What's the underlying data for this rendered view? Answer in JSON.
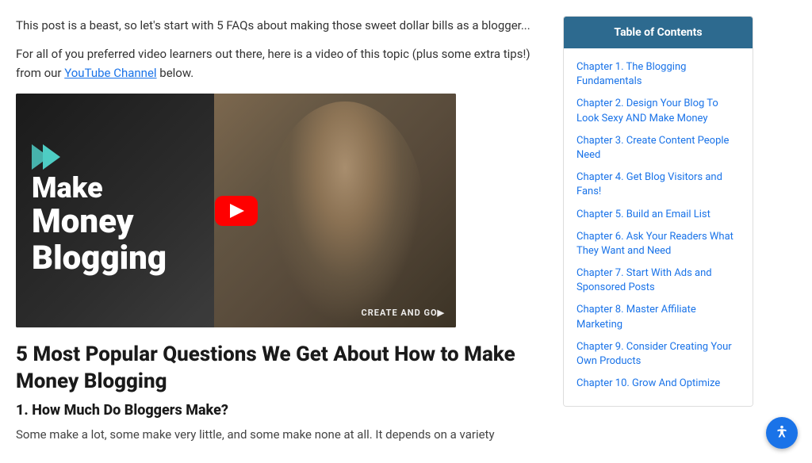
{
  "intro": {
    "paragraph1": "This post is a beast, so let's start with 5 FAQs about making those sweet dollar bills as a blogger...",
    "paragraph2_before_link": "For all of you preferred video learners out there, here is a video of this topic (plus some extra tips!) from our ",
    "link_text": "YouTube Channel",
    "paragraph2_after_link": " below."
  },
  "video": {
    "line1": "Make",
    "line2": "Money",
    "line3": "Blogging",
    "watermark": "CREATE AND GO▶",
    "play_label": "Play video"
  },
  "main": {
    "section_heading": "5 Most Popular Questions We Get About How to Make Money Blogging",
    "sub_heading": "1. How Much Do Bloggers Make?",
    "body_text": "Some make a lot, some make very little, and some make none at all. It depends on a variety"
  },
  "toc": {
    "header": "Table of Contents",
    "items": [
      {
        "label": "Chapter 1. The Blogging Fundamentals"
      },
      {
        "label": "Chapter 2. Design Your Blog To Look Sexy AND Make Money"
      },
      {
        "label": "Chapter 3. Create Content People Need"
      },
      {
        "label": "Chapter 4. Get Blog Visitors and Fans!"
      },
      {
        "label": "Chapter 5. Build an Email List"
      },
      {
        "label": "Chapter 6. Ask Your Readers What They Want and Need"
      },
      {
        "label": "Chapter 7. Start With Ads and Sponsored Posts"
      },
      {
        "label": "Chapter 8. Master Affiliate Marketing"
      },
      {
        "label": "Chapter 9. Consider Creating Your Own Products"
      },
      {
        "label": "Chapter 10. Grow And Optimize"
      }
    ]
  },
  "accessibility": {
    "label": "Accessibility options"
  }
}
